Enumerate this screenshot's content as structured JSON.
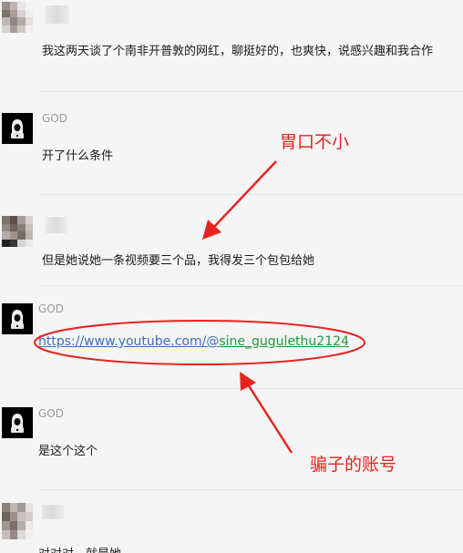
{
  "messages": [
    {
      "sender": "",
      "text": "我这两天谈了个南非开普敦的网红，聊挺好的，也爽快，说感兴趣和我合作"
    },
    {
      "sender": "GOD",
      "text": "开了什么条件"
    },
    {
      "sender": "",
      "text": "但是她说她一条视频要三个品，我得发三个包包给她"
    },
    {
      "sender": "GOD",
      "link_part1": "https://www.youtube.com/@",
      "link_part2": "sine_gugulethu2124"
    },
    {
      "sender": "GOD",
      "text": "是这个这个"
    },
    {
      "sender": "",
      "text": "对对对，就是她"
    }
  ],
  "annotations": {
    "appetite": "胃口不小",
    "scammer": "骗子的账号"
  },
  "colors": {
    "annotation": "#e8231f",
    "link_blue": "#3a6fb6",
    "link_green": "#1f9a3a",
    "background": "#f5f5f5"
  },
  "icons": {
    "god_avatar": "hooded-figure-icon",
    "user_avatar": "pixelated-avatar"
  }
}
